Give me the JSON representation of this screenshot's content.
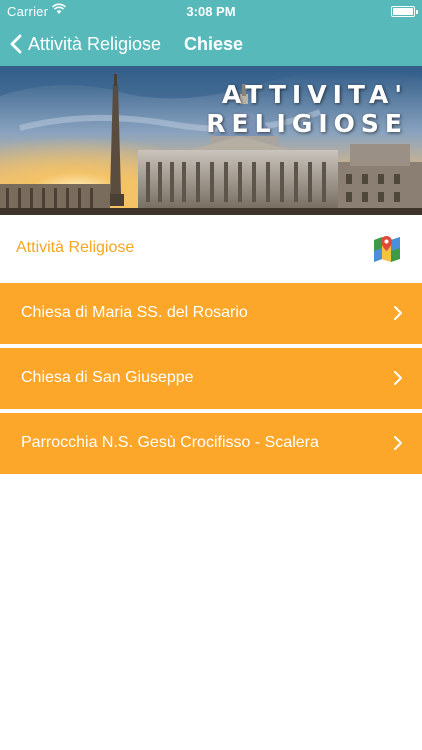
{
  "status_bar": {
    "carrier": "Carrier",
    "time": "3:08 PM"
  },
  "nav": {
    "back_label": "Attività Religiose",
    "title": "Chiese"
  },
  "banner": {
    "line1": "ATTIVITA'",
    "line2": "RELIGIOSE"
  },
  "section": {
    "title": "Attività Religiose",
    "map_icon": "map-pin-icon"
  },
  "list": {
    "items": [
      {
        "label": "Chiesa di Maria SS. del Rosario"
      },
      {
        "label": "Chiesa di San Giuseppe"
      },
      {
        "label": "Parrocchia N.S. Gesù Crocifisso - Scalera"
      }
    ]
  },
  "colors": {
    "nav_bg": "#58b9bb",
    "accent": "#f5a623",
    "row_bg": "#fca72a"
  }
}
